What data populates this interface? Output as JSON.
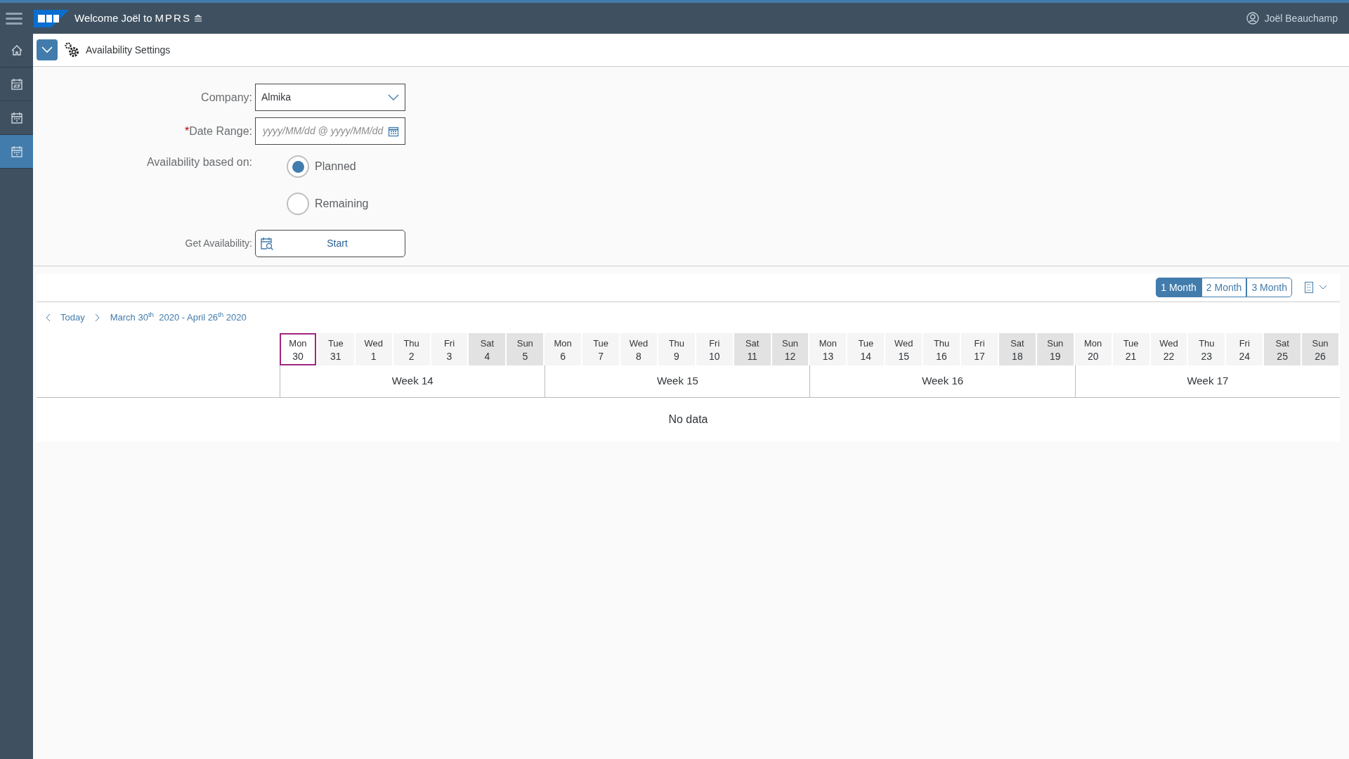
{
  "shell": {
    "title": "Welcome Joël to",
    "brand": "MPRS",
    "user": "Joël Beauchamp"
  },
  "sidebar": {
    "items": [
      {
        "kind": "home",
        "selected": false
      },
      {
        "kind": "schedule",
        "selected": false
      },
      {
        "kind": "calendar",
        "selected": false
      },
      {
        "kind": "calendar",
        "selected": true
      }
    ]
  },
  "toolbar": {
    "title": "Availability Settings"
  },
  "form": {
    "company": {
      "label": "Company:",
      "value": "Almika"
    },
    "date_range": {
      "label": "Date Range:",
      "required": true,
      "required_mark": "*",
      "placeholder": "yyyy/MM/dd @ yyyy/MM/dd"
    },
    "based_on": {
      "label": "Availability based on:",
      "options": [
        {
          "label": "Planned",
          "selected": true
        },
        {
          "label": "Remaining",
          "selected": false
        }
      ]
    },
    "get": {
      "label": "Get Availability:",
      "button": "Start"
    }
  },
  "calendar": {
    "views": [
      {
        "label": "1 Month",
        "selected": true
      },
      {
        "label": "2 Month",
        "selected": false
      },
      {
        "label": "3 Month",
        "selected": false
      }
    ],
    "today": "Today",
    "range": "March 30$^{th}$  2020 - April 26$^{th}$ 2020",
    "days": [
      {
        "day": "Mon",
        "date": "30",
        "weekend": false,
        "today": true
      },
      {
        "day": "Tue",
        "date": "31",
        "weekend": false,
        "today": false
      },
      {
        "day": "Wed",
        "date": "1",
        "weekend": false,
        "today": false
      },
      {
        "day": "Thu",
        "date": "2",
        "weekend": false,
        "today": false
      },
      {
        "day": "Fri",
        "date": "3",
        "weekend": false,
        "today": false
      },
      {
        "day": "Sat",
        "date": "4",
        "weekend": true,
        "today": false
      },
      {
        "day": "Sun",
        "date": "5",
        "weekend": true,
        "today": false
      },
      {
        "day": "Mon",
        "date": "6",
        "weekend": false,
        "today": false
      },
      {
        "day": "Tue",
        "date": "7",
        "weekend": false,
        "today": false
      },
      {
        "day": "Wed",
        "date": "8",
        "weekend": false,
        "today": false
      },
      {
        "day": "Thu",
        "date": "9",
        "weekend": false,
        "today": false
      },
      {
        "day": "Fri",
        "date": "10",
        "weekend": false,
        "today": false
      },
      {
        "day": "Sat",
        "date": "11",
        "weekend": true,
        "today": false
      },
      {
        "day": "Sun",
        "date": "12",
        "weekend": true,
        "today": false
      },
      {
        "day": "Mon",
        "date": "13",
        "weekend": false,
        "today": false
      },
      {
        "day": "Tue",
        "date": "14",
        "weekend": false,
        "today": false
      },
      {
        "day": "Wed",
        "date": "15",
        "weekend": false,
        "today": false
      },
      {
        "day": "Thu",
        "date": "16",
        "weekend": false,
        "today": false
      },
      {
        "day": "Fri",
        "date": "17",
        "weekend": false,
        "today": false
      },
      {
        "day": "Sat",
        "date": "18",
        "weekend": true,
        "today": false
      },
      {
        "day": "Sun",
        "date": "19",
        "weekend": true,
        "today": false
      },
      {
        "day": "Mon",
        "date": "20",
        "weekend": false,
        "today": false
      },
      {
        "day": "Tue",
        "date": "21",
        "weekend": false,
        "today": false
      },
      {
        "day": "Wed",
        "date": "22",
        "weekend": false,
        "today": false
      },
      {
        "day": "Thu",
        "date": "23",
        "weekend": false,
        "today": false
      },
      {
        "day": "Fri",
        "date": "24",
        "weekend": false,
        "today": false
      },
      {
        "day": "Sat",
        "date": "25",
        "weekend": true,
        "today": false
      },
      {
        "day": "Sun",
        "date": "26",
        "weekend": true,
        "today": false
      }
    ],
    "weeks": [
      "Week 14",
      "Week 15",
      "Week 16",
      "Week 17"
    ],
    "empty": "No data"
  }
}
